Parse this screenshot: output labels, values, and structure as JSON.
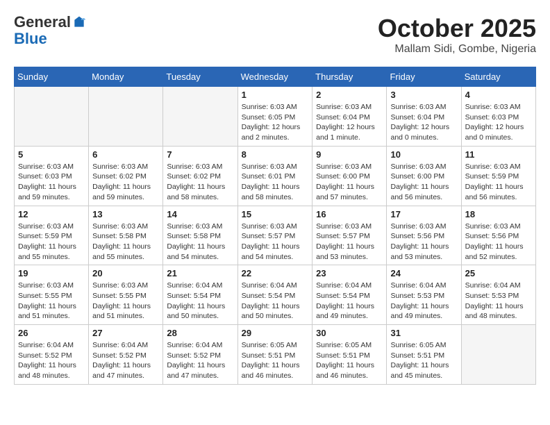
{
  "header": {
    "logo_general": "General",
    "logo_blue": "Blue",
    "month_title": "October 2025",
    "location": "Mallam Sidi, Gombe, Nigeria"
  },
  "weekdays": [
    "Sunday",
    "Monday",
    "Tuesday",
    "Wednesday",
    "Thursday",
    "Friday",
    "Saturday"
  ],
  "weeks": [
    [
      {
        "day": "",
        "info": ""
      },
      {
        "day": "",
        "info": ""
      },
      {
        "day": "",
        "info": ""
      },
      {
        "day": "1",
        "info": "Sunrise: 6:03 AM\nSunset: 6:05 PM\nDaylight: 12 hours\nand 2 minutes."
      },
      {
        "day": "2",
        "info": "Sunrise: 6:03 AM\nSunset: 6:04 PM\nDaylight: 12 hours\nand 1 minute."
      },
      {
        "day": "3",
        "info": "Sunrise: 6:03 AM\nSunset: 6:04 PM\nDaylight: 12 hours\nand 0 minutes."
      },
      {
        "day": "4",
        "info": "Sunrise: 6:03 AM\nSunset: 6:03 PM\nDaylight: 12 hours\nand 0 minutes."
      }
    ],
    [
      {
        "day": "5",
        "info": "Sunrise: 6:03 AM\nSunset: 6:03 PM\nDaylight: 11 hours\nand 59 minutes."
      },
      {
        "day": "6",
        "info": "Sunrise: 6:03 AM\nSunset: 6:02 PM\nDaylight: 11 hours\nand 59 minutes."
      },
      {
        "day": "7",
        "info": "Sunrise: 6:03 AM\nSunset: 6:02 PM\nDaylight: 11 hours\nand 58 minutes."
      },
      {
        "day": "8",
        "info": "Sunrise: 6:03 AM\nSunset: 6:01 PM\nDaylight: 11 hours\nand 58 minutes."
      },
      {
        "day": "9",
        "info": "Sunrise: 6:03 AM\nSunset: 6:00 PM\nDaylight: 11 hours\nand 57 minutes."
      },
      {
        "day": "10",
        "info": "Sunrise: 6:03 AM\nSunset: 6:00 PM\nDaylight: 11 hours\nand 56 minutes."
      },
      {
        "day": "11",
        "info": "Sunrise: 6:03 AM\nSunset: 5:59 PM\nDaylight: 11 hours\nand 56 minutes."
      }
    ],
    [
      {
        "day": "12",
        "info": "Sunrise: 6:03 AM\nSunset: 5:59 PM\nDaylight: 11 hours\nand 55 minutes."
      },
      {
        "day": "13",
        "info": "Sunrise: 6:03 AM\nSunset: 5:58 PM\nDaylight: 11 hours\nand 55 minutes."
      },
      {
        "day": "14",
        "info": "Sunrise: 6:03 AM\nSunset: 5:58 PM\nDaylight: 11 hours\nand 54 minutes."
      },
      {
        "day": "15",
        "info": "Sunrise: 6:03 AM\nSunset: 5:57 PM\nDaylight: 11 hours\nand 54 minutes."
      },
      {
        "day": "16",
        "info": "Sunrise: 6:03 AM\nSunset: 5:57 PM\nDaylight: 11 hours\nand 53 minutes."
      },
      {
        "day": "17",
        "info": "Sunrise: 6:03 AM\nSunset: 5:56 PM\nDaylight: 11 hours\nand 53 minutes."
      },
      {
        "day": "18",
        "info": "Sunrise: 6:03 AM\nSunset: 5:56 PM\nDaylight: 11 hours\nand 52 minutes."
      }
    ],
    [
      {
        "day": "19",
        "info": "Sunrise: 6:03 AM\nSunset: 5:55 PM\nDaylight: 11 hours\nand 51 minutes."
      },
      {
        "day": "20",
        "info": "Sunrise: 6:03 AM\nSunset: 5:55 PM\nDaylight: 11 hours\nand 51 minutes."
      },
      {
        "day": "21",
        "info": "Sunrise: 6:04 AM\nSunset: 5:54 PM\nDaylight: 11 hours\nand 50 minutes."
      },
      {
        "day": "22",
        "info": "Sunrise: 6:04 AM\nSunset: 5:54 PM\nDaylight: 11 hours\nand 50 minutes."
      },
      {
        "day": "23",
        "info": "Sunrise: 6:04 AM\nSunset: 5:54 PM\nDaylight: 11 hours\nand 49 minutes."
      },
      {
        "day": "24",
        "info": "Sunrise: 6:04 AM\nSunset: 5:53 PM\nDaylight: 11 hours\nand 49 minutes."
      },
      {
        "day": "25",
        "info": "Sunrise: 6:04 AM\nSunset: 5:53 PM\nDaylight: 11 hours\nand 48 minutes."
      }
    ],
    [
      {
        "day": "26",
        "info": "Sunrise: 6:04 AM\nSunset: 5:52 PM\nDaylight: 11 hours\nand 48 minutes."
      },
      {
        "day": "27",
        "info": "Sunrise: 6:04 AM\nSunset: 5:52 PM\nDaylight: 11 hours\nand 47 minutes."
      },
      {
        "day": "28",
        "info": "Sunrise: 6:04 AM\nSunset: 5:52 PM\nDaylight: 11 hours\nand 47 minutes."
      },
      {
        "day": "29",
        "info": "Sunrise: 6:05 AM\nSunset: 5:51 PM\nDaylight: 11 hours\nand 46 minutes."
      },
      {
        "day": "30",
        "info": "Sunrise: 6:05 AM\nSunset: 5:51 PM\nDaylight: 11 hours\nand 46 minutes."
      },
      {
        "day": "31",
        "info": "Sunrise: 6:05 AM\nSunset: 5:51 PM\nDaylight: 11 hours\nand 45 minutes."
      },
      {
        "day": "",
        "info": ""
      }
    ]
  ]
}
